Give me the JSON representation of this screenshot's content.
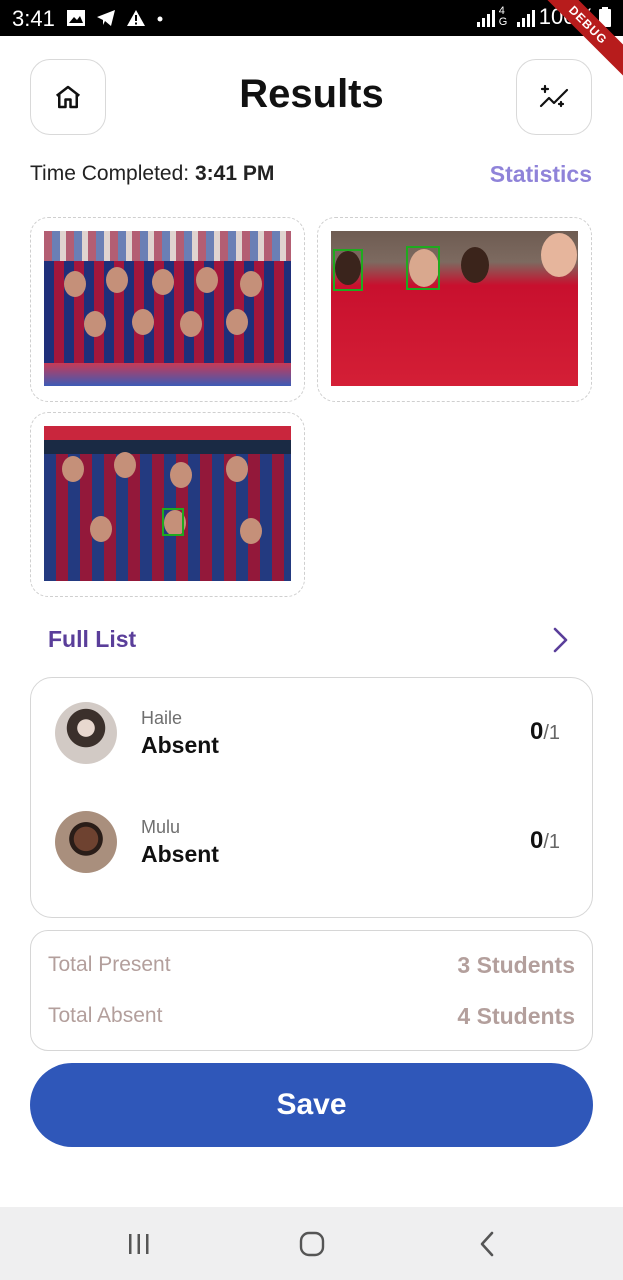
{
  "status_bar": {
    "time": "3:41",
    "network": "4G",
    "battery": "100%",
    "debug_label": "DEBUG"
  },
  "header": {
    "title": "Results",
    "home_icon": "home-icon",
    "stats_icon": "sparkle-chart-icon"
  },
  "summary_line": {
    "label": "Time Completed:",
    "time": "3:41 PM",
    "statistics_link": "Statistics"
  },
  "photos": [
    {
      "name": "team-photo-1",
      "faces_marked": 0
    },
    {
      "name": "team-photo-2",
      "faces_marked": 2
    },
    {
      "name": "team-photo-3",
      "faces_marked": 1
    }
  ],
  "full_list": {
    "title": "Full List",
    "students": [
      {
        "name": "Haile",
        "status": "Absent",
        "score": "0",
        "total": "/1"
      },
      {
        "name": "Mulu",
        "status": "Absent",
        "score": "0",
        "total": "/1"
      }
    ]
  },
  "totals": {
    "present_label": "Total Present",
    "present_value": "3 Students",
    "absent_label": "Total Absent",
    "absent_value": "4 Students"
  },
  "save_label": "Save",
  "colors": {
    "accent_purple": "#8f83d9",
    "title_purple": "#5a3e9a",
    "save_blue": "#2f57b9",
    "muted_text": "#b39f9c"
  }
}
